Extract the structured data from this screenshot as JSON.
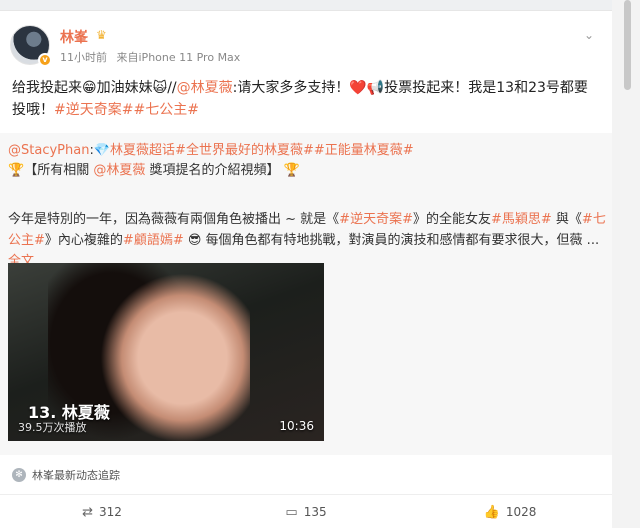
{
  "post": {
    "username": "林峯",
    "crown_icon": "crown-icon",
    "time": "11小时前",
    "source": "来自iPhone 11 Pro Max",
    "more_icon": "chevron-down-icon",
    "content": {
      "t1": "给我投起来",
      "e1": "😁",
      "t2": "加油妹妹",
      "e2": "🙀",
      "t3": "//",
      "mention": "@林夏薇",
      "t4": ":请大家多多支持！",
      "e3": "❤️",
      "e4": "📢",
      "t5": "投票投起来！我是13和23号都要投哦！",
      "tag1": "#逆天奇案#",
      "tag2": "#七公主#"
    }
  },
  "quote": {
    "line1": {
      "user": "@StacyPhan",
      "sep": ":",
      "e1": "💎",
      "tag1": "林夏薇超话",
      "tag2": "#全世界最好的林夏薇#",
      "tag3": "#正能量林夏薇#"
    },
    "line2": {
      "e1": "🏆",
      "t1": "【所有相關",
      "mention": "@林夏薇",
      "t2": "獎項提名的介紹視頻】",
      "e2": "🏆"
    },
    "body": {
      "t1": "今年是特別的一年，因為薇薇有兩個角色被播出 ~ 就是《",
      "tag1": "#逆天奇案#",
      "t2": "》的全能女友",
      "tag2": "#馬穎思#",
      "t3": " 與《",
      "tag3": "#七公主#",
      "t4": "》內心複雜的",
      "tag4": "#顧語嫣#",
      "e1": "😎",
      "t5": " 每個角色都有特地挑戰，對演員的演技和感情都有要求很大，但薇 ... ",
      "more": "全文"
    },
    "video": {
      "title": "13. 林夏薇",
      "subtitle": "39.5万次播放",
      "duration": "10:36"
    }
  },
  "footer": {
    "source_label": "林峯最新动态追踪",
    "repost_count": "312",
    "comment_count": "135",
    "like_count": "1028"
  },
  "colors": {
    "link": "#eb7350",
    "background": "#eef0f2"
  }
}
